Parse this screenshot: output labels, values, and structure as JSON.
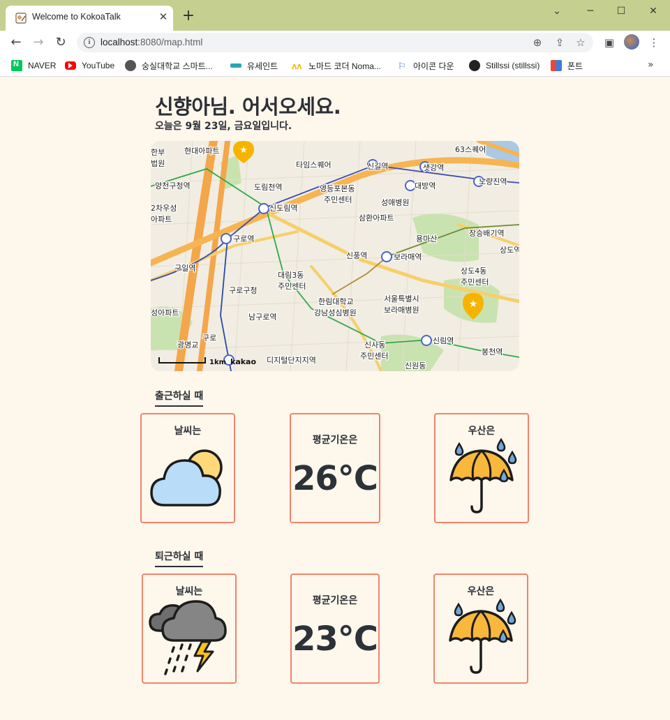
{
  "browser": {
    "tab_title": "Welcome to KokoaTalk",
    "url_host": "localhost",
    "url_rest": ":8080/map.html",
    "bookmarks": [
      {
        "label": "NAVER",
        "color": "#03c75a"
      },
      {
        "label": "YouTube",
        "color": "#ff0000"
      },
      {
        "label": "숭실대학교 스마트...",
        "color": "#444444"
      },
      {
        "label": "유세인트",
        "color": "#2aa5b5"
      },
      {
        "label": "노마드 코더 Noma...",
        "color": "#f6b500"
      },
      {
        "label": "아이콘 다운",
        "color": "#3f6fd8"
      },
      {
        "label": "Stillssi (stillssi)",
        "color": "#222222"
      },
      {
        "label": "폰트",
        "color": "#e34a3a"
      }
    ]
  },
  "page": {
    "greeting": "신향아님. 어서오세요.",
    "date_line": "오늘은 9월 23일, 금요일입니다."
  },
  "map": {
    "scale_label": "1km",
    "logo": "kakao",
    "labels": [
      "현대아파트",
      "타임스퀘어",
      "신길역",
      "샛강역",
      "63스퀘어",
      "대방역",
      "노량진역",
      "영등포본동",
      "주민센터",
      "성애병원",
      "신도림역",
      "신도림역",
      "구로역",
      "삼환아파트",
      "용마산",
      "신풍역",
      "보라매역",
      "상도4동",
      "주민센터",
      "구일역",
      "대림3동",
      "주민센터",
      "구로구청",
      "한림대학교",
      "강남성심병원",
      "서울특별시",
      "보라매병원",
      "신사동",
      "주민센터",
      "신림역",
      "봉천역",
      "광명교",
      "구로",
      "신원동",
      "남구로역",
      "도림천역",
      "양천구청역",
      "장승배기역",
      "상도역",
      "디지털단지지역",
      "한부",
      "법원",
      "2차우성",
      "아파트",
      "성아파트"
    ]
  },
  "commute": {
    "title": "출근하실 때",
    "weather_label": "날씨는",
    "weather_icon": "partly-cloudy-icon",
    "temp_label": "평균기온은",
    "temp_value": "26°C",
    "umbrella_label": "우산은",
    "umbrella_icon": "umbrella-rain-icon"
  },
  "return": {
    "title": "퇴근하실 때",
    "weather_label": "날씨는",
    "weather_icon": "thunderstorm-rain-icon",
    "temp_label": "평균기온은",
    "temp_value": "23°C",
    "umbrella_label": "우산은",
    "umbrella_icon": "umbrella-rain-icon"
  },
  "colors": {
    "card_border": "#f0846c",
    "page_bg": "#fdf7ec",
    "text": "#2c2f36"
  }
}
